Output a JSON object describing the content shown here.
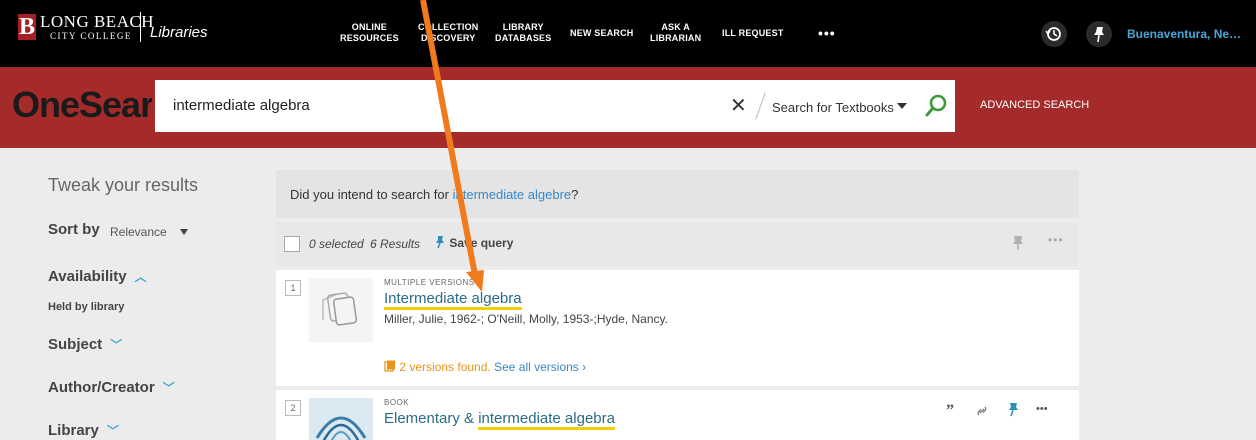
{
  "header": {
    "logo_letter": "B",
    "logo_name": "LONG BEACH",
    "logo_sub": "CITY COLLEGE",
    "logo_libs": "Libraries",
    "nav": [
      {
        "line1": "ONLINE",
        "line2": "RESOURCES"
      },
      {
        "line1": "COLLECTION",
        "line2": "DISCOVERY"
      },
      {
        "line1": "LIBRARY",
        "line2": "DATABASES"
      },
      {
        "line1": "NEW SEARCH",
        "line2": ""
      },
      {
        "line1": "ASK A",
        "line2": "LIBRARIAN"
      },
      {
        "line1": "ILL REQUEST",
        "line2": ""
      }
    ],
    "more": "•••",
    "user": "Buenaventura, Ne…"
  },
  "search": {
    "brand": "OneSearch",
    "query": "intermediate algebra",
    "clear": "✕",
    "scope": "Search for Textbooks",
    "advanced": "ADVANCED SEARCH"
  },
  "facets": {
    "tweak": "Tweak your results",
    "sort_label": "Sort by",
    "sort_value": "Relevance",
    "availability": "Availability",
    "held": "Held by library",
    "subject": "Subject",
    "author": "Author/Creator",
    "library": "Library"
  },
  "did_you_mean": {
    "prefix": "Did you intend to search for",
    "suggestion": "intermediate algebre",
    "suffix": "?"
  },
  "toolbar": {
    "selected": "0 selected",
    "results": "6 Results",
    "save": "Save query",
    "more": "•••"
  },
  "results": [
    {
      "num": "1",
      "type": "MULTIPLE VERSIONS",
      "title": "Intermediate algebra",
      "authors": "Miller, Julie, 1962-; O'Neill, Molly, 1953-;Hyde, Nancy.",
      "versions": "2 versions found.",
      "see_all": "See all versions"
    },
    {
      "num": "2",
      "type": "BOOK",
      "title_prefix": "Elementary & ",
      "title_hl": "intermediate algebra"
    }
  ],
  "colors": {
    "header_bg": "#000000",
    "search_band": "#a52a2a",
    "link": "#3a87c4",
    "title": "#2a6c8a",
    "highlight": "#f5d000",
    "arrow": "#f07a1e"
  }
}
